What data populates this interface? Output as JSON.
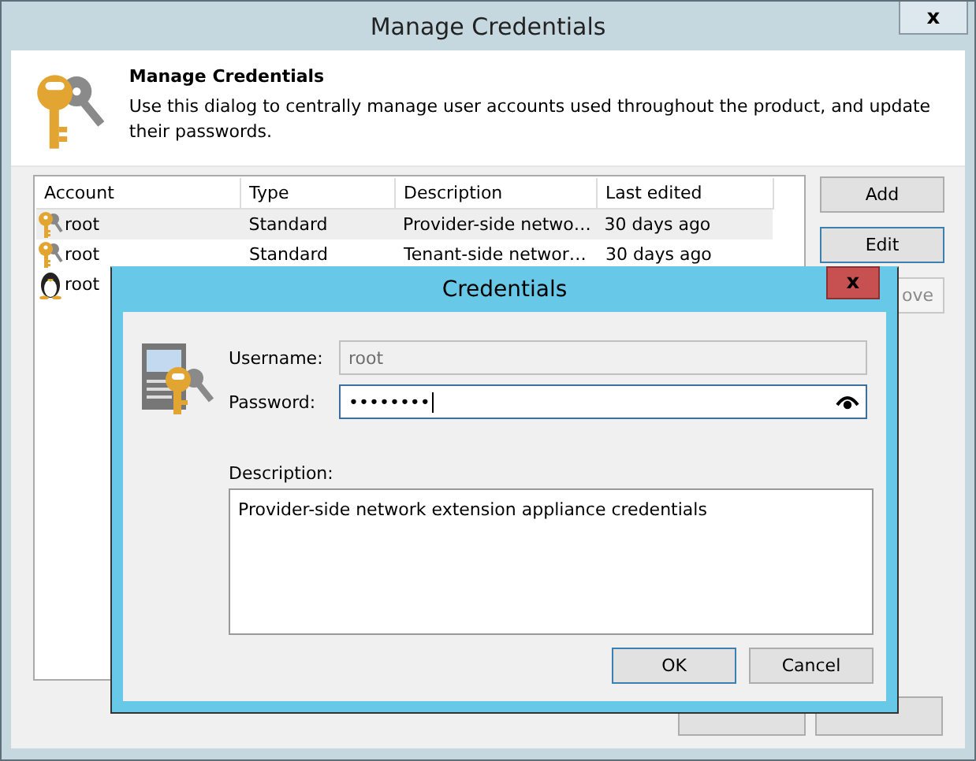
{
  "window": {
    "title": "Manage Credentials"
  },
  "header": {
    "title": "Manage Credentials",
    "description": "Use this dialog to centrally manage user accounts used throughout the product, and update their passwords."
  },
  "table": {
    "columns": [
      "Account",
      "Type",
      "Description",
      "Last edited"
    ],
    "rows": [
      {
        "kind": "key",
        "selected": true,
        "cells": [
          "root",
          "Standard",
          "Provider-side netwo…",
          "30 days ago"
        ]
      },
      {
        "kind": "key",
        "selected": false,
        "cells": [
          "root",
          "Standard",
          "Tenant-side networ…",
          "30 days ago"
        ]
      },
      {
        "kind": "linux",
        "selected": false,
        "cells": [
          "root"
        ]
      }
    ]
  },
  "side_buttons": [
    {
      "label": "Add",
      "focused": false,
      "disabled": false
    },
    {
      "label": "Edit",
      "focused": true,
      "disabled": false
    },
    {
      "label": "ove",
      "focused": false,
      "disabled": true
    }
  ],
  "dialog": {
    "title": "Credentials",
    "close": "x",
    "username": {
      "label": "Username:",
      "value": "root",
      "disabled": true
    },
    "password": {
      "label": "Password:",
      "value": "••••••••"
    },
    "description": {
      "label": "Description:",
      "value": "Provider-side network extension appliance credentials"
    },
    "buttons": [
      {
        "label": "OK",
        "focused": true
      },
      {
        "label": "Cancel",
        "focused": false
      }
    ]
  },
  "window_close": "x"
}
